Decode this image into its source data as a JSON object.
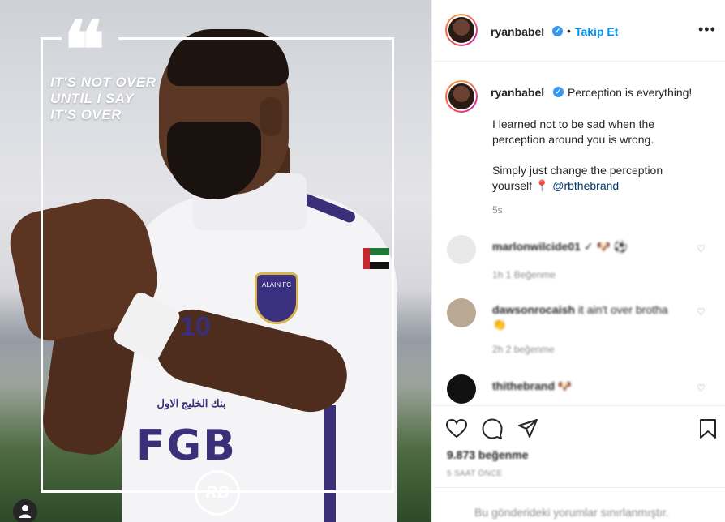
{
  "post": {
    "username": "ryanbabel",
    "verified_mark": "✓",
    "separator": "•",
    "follow_label": "Takip Et",
    "more_label": "•••"
  },
  "image": {
    "quote_mark": "❝",
    "quote_lines": [
      "IT'S NOT OVER",
      "UNTIL I SAY",
      "IT'S OVER"
    ],
    "club_badge": "ALAIN FC",
    "sponsor_ar": "بنك الخليج الاول",
    "sponsor": "FGB",
    "shirt_number": "10",
    "brand_logo": "RB"
  },
  "caption": {
    "username": "ryanbabel",
    "first_line": "Perception is everything!",
    "lines": [
      "I learned not to be sad when the",
      "perception around you is wrong.",
      "Simply just change the perception",
      "yourself"
    ],
    "pin_emoji": "📍",
    "mention": "@rbthebrand",
    "time": "5s"
  },
  "comments": [
    {
      "user": "marlonwilcide01",
      "text": "✓ 🐶 ⚽",
      "meta": "1h    1 Beğenme",
      "heart": "♡"
    },
    {
      "user": "dawsonrocaish",
      "text": "it ain't over brotha",
      "text2": "👏",
      "meta": "2h    2 beğenme",
      "heart": "♡"
    },
    {
      "user": "thithebrand",
      "text": "🐶",
      "meta": "",
      "heart": "♡"
    }
  ],
  "actions": {
    "likes": "9.873 beğenme",
    "date": "5 SAAT ÖNCE",
    "comment_placeholder": "Bu gönderideki yorumlar sınırlanmıştır."
  },
  "colors": {
    "accent_blue": "#0095f6",
    "verified_blue": "#3897f0",
    "jersey_purple": "#3a2f78",
    "muted_text": "#8e8e8e"
  },
  "icons": [
    "heart-icon",
    "comment-icon",
    "share-icon",
    "bookmark-icon",
    "user-tag-icon"
  ]
}
